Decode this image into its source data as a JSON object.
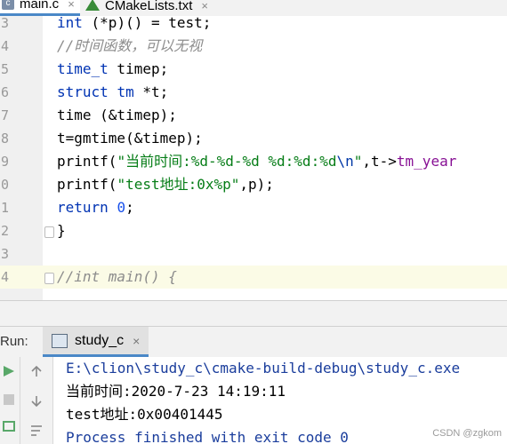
{
  "tabs": [
    {
      "label": "main.c",
      "icon": "c-file-icon",
      "active": true
    },
    {
      "label": "CMakeLists.txt",
      "icon": "cmake-icon",
      "active": false
    }
  ],
  "editor": {
    "lines": [
      {
        "num": "3",
        "text": "int (*p)() = test;"
      },
      {
        "num": "4",
        "text": "//时间函数，可以无视"
      },
      {
        "num": "5",
        "text": "time_t timep;"
      },
      {
        "num": "6",
        "text": "struct tm *t;"
      },
      {
        "num": "7",
        "text": "time (&timep);"
      },
      {
        "num": "8",
        "text": "t=gmtime(&timep);"
      },
      {
        "num": "9",
        "text": "printf(\"当前时间:%d-%d-%d %d:%d:%d\\n\",t->tm_year"
      },
      {
        "num": "0",
        "text": "printf(\"test地址:0x%p\",p);"
      },
      {
        "num": "1",
        "text": "return 0;"
      },
      {
        "num": "2",
        "text": "}"
      },
      {
        "num": "3",
        "text": ""
      },
      {
        "num": "4",
        "text": "//int main() {"
      }
    ]
  },
  "run": {
    "label": "Run:",
    "tab_label": "study_c"
  },
  "console": {
    "lines": [
      "E:\\clion\\study_c\\cmake-build-debug\\study_c.exe",
      "当前时间:2020-7-23 14:19:11",
      "test地址:0x00401445",
      "Process finished with exit code 0"
    ]
  },
  "watermark": "CSDN @zgkom"
}
